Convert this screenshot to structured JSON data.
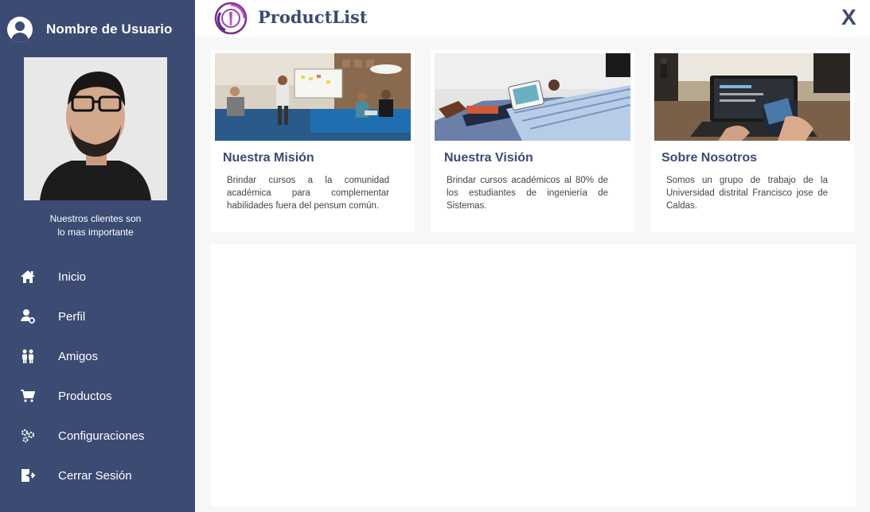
{
  "sidebar": {
    "username": "Nombre de Usuario",
    "tagline_line1": "Nuestros clientes son",
    "tagline_line2": "lo mas importante",
    "items": [
      {
        "label": "Inicio",
        "icon": "home-icon"
      },
      {
        "label": "Perfil",
        "icon": "user-settings-icon"
      },
      {
        "label": "Amigos",
        "icon": "friends-icon"
      },
      {
        "label": "Productos",
        "icon": "cart-icon"
      },
      {
        "label": "Configuraciones",
        "icon": "gears-icon"
      },
      {
        "label": "Cerrar Sesión",
        "icon": "logout-icon"
      }
    ]
  },
  "header": {
    "brand": "ProductList",
    "close": "X"
  },
  "cards": [
    {
      "title": "Nuestra Misión",
      "text": "Brindar cursos a la comunidad académica para complementar habilidades fuera del pensum común."
    },
    {
      "title": "Nuestra Visión",
      "text": "Brindar cursos académicos al 80% de los estudiantes de ingeniería de Sistemas."
    },
    {
      "title": "Sobre Nosotros",
      "text": "Somos un grupo de trabajo de la Universidad distrital Francisco jose de Caldas."
    }
  ],
  "colors": {
    "sidebar_bg": "#3b4b73",
    "accent": "#3b4b73",
    "page_bg": "#f7f7f7"
  }
}
